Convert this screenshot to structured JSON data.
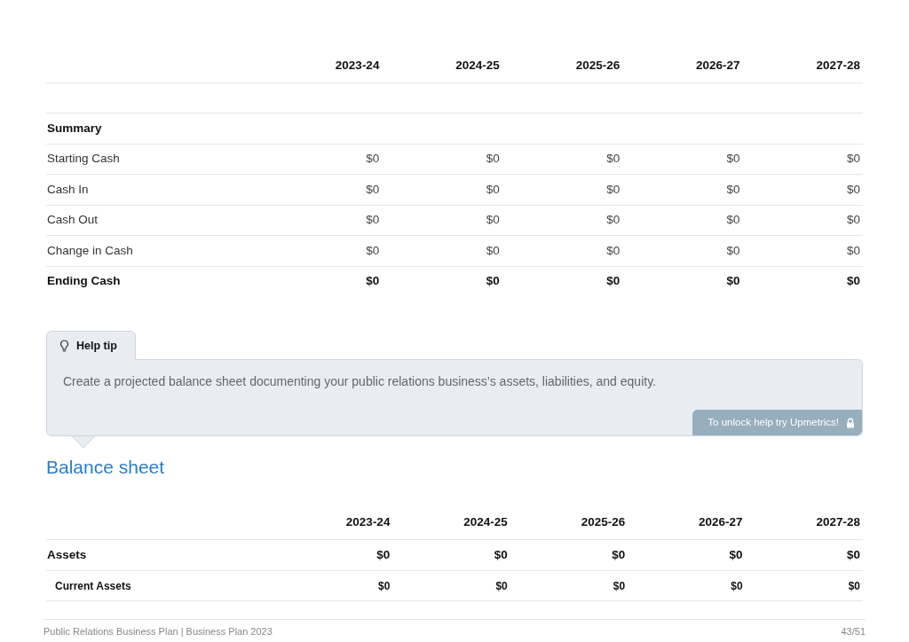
{
  "cash_table": {
    "columns": [
      "",
      "2023-24",
      "2024-25",
      "2025-26",
      "2026-27",
      "2027-28"
    ],
    "rows": [
      {
        "kind": "blank",
        "label": "",
        "values": []
      },
      {
        "kind": "section",
        "label": "Summary",
        "values": []
      },
      {
        "kind": "normal",
        "label": "Starting Cash",
        "values": [
          "$0",
          "$0",
          "$0",
          "$0",
          "$0"
        ]
      },
      {
        "kind": "normal",
        "label": "Cash In",
        "values": [
          "$0",
          "$0",
          "$0",
          "$0",
          "$0"
        ]
      },
      {
        "kind": "normal",
        "label": "Cash Out",
        "values": [
          "$0",
          "$0",
          "$0",
          "$0",
          "$0"
        ]
      },
      {
        "kind": "normal",
        "label": "Change in Cash",
        "values": [
          "$0",
          "$0",
          "$0",
          "$0",
          "$0"
        ]
      },
      {
        "kind": "total",
        "label": "Ending Cash",
        "values": [
          "$0",
          "$0",
          "$0",
          "$0",
          "$0"
        ]
      }
    ]
  },
  "help_tip": {
    "tab_label": "Help tip",
    "text": "Create a projected balance sheet documenting your public relations business’s assets, liabilities, and equity.",
    "unlock_label": "To unlock help try Upmetrics!"
  },
  "balance_sheet": {
    "title": "Balance sheet",
    "columns": [
      "",
      "2023-24",
      "2024-25",
      "2025-26",
      "2026-27",
      "2027-28"
    ],
    "rows": [
      {
        "kind": "total",
        "label": "Assets",
        "values": [
          "$0",
          "$0",
          "$0",
          "$0",
          "$0"
        ]
      },
      {
        "kind": "subtotal",
        "label": "Current Assets",
        "values": [
          "$0",
          "$0",
          "$0",
          "$0",
          "$0"
        ]
      }
    ]
  },
  "footer": {
    "document": "Public Relations Business Plan | Business Plan 2023",
    "page": "43/51"
  }
}
